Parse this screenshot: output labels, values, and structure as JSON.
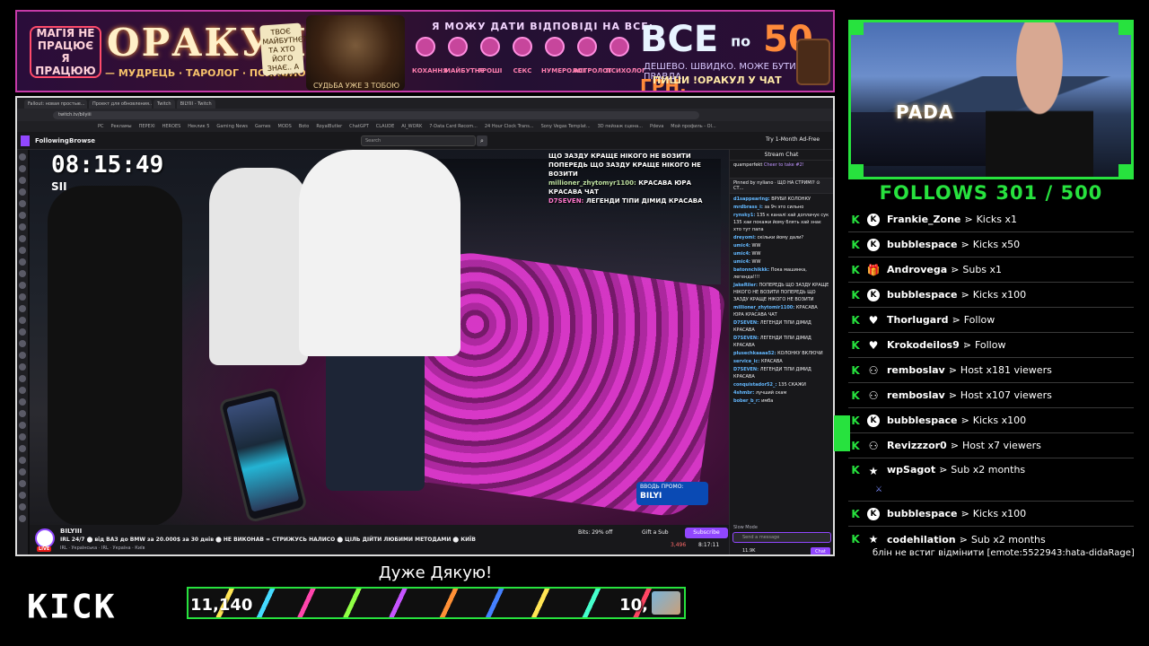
{
  "banner": {
    "left_pill": "МАГІЯ НЕ ПРАЦЮЄ Я ПРАЦЮЮ",
    "title": "ОРАКУЛ",
    "subtitle": "— МУДРЕЦЬ · ТАРОЛОГ · ПСИХОЛОГ —",
    "future_card": "ТВОЄ МАЙБУТНЄ? ТА ХТО ЙОГО ЗНАЄ.. А Я ЗНАЮ",
    "wizard_label": "СУДЬБА УЖЕ З ТОБОЮ",
    "can_answer": "Я МОЖУ ДАТИ ВІДПОВІДІ НА ВСЕ:",
    "categories": [
      "КОХАННЯ",
      "МАЙБУТНЄ",
      "ГРОШІ",
      "СЕКС",
      "НУМЕРОЛОГ",
      "АСТРОЛОГ",
      "ПСИХОЛОГ"
    ],
    "price_all": "ВСЕ",
    "price_po": "по",
    "price_num": "50",
    "price_cur": "ГРН.",
    "price_sub": "ДЕШЕВО. ШВИДКО. МОЖЕ БУТИ ПРАВДА.",
    "price_cta": "ПИШИ !ОРАКУЛ У ЧАТ"
  },
  "browser": {
    "tabs": [
      "Fallout: новая простые...",
      "Проект для обновления...",
      "Twitch",
      "BILYIII - Twitch"
    ],
    "url": "twitch.tv/bilyiii",
    "bookmarks": [
      "PC",
      "Рекламы",
      "ПЕРЕХІ",
      "HEROES",
      "Неклик 5",
      "Gaming News",
      "Games",
      "MODS",
      "Boto",
      "RoyalButler",
      "ChatGPT",
      "CLAUDE",
      "AI_WORK",
      "7-Data Card Recom...",
      "24 Hour Clock Trans...",
      "Sony Vegas Templat...",
      "3D пейзаж сцена...",
      "Pdeva",
      "Мой профиль - Ol..."
    ]
  },
  "twitch_nav": {
    "following": "Following",
    "browse": "Browse",
    "search_placeholder": "Search",
    "adfree": "Try 1-Month Ad-Free"
  },
  "video": {
    "clock": "08:15:49",
    "clock_sub": "SII",
    "overlay_chat": [
      {
        "text": "ЩО ЗАЗДУ КРАЩЕ НІКОГО НЕ ВОЗИТИ ПОПЕРЕДЬ ЩО ЗАЗДУ КРАЩЕ НІКОГО НЕ ВОЗИТИ"
      },
      {
        "name": "millioner_zhytomyr1100:",
        "text": "КРАСАВА ЮРА КРАСАВА ЧАТ"
      },
      {
        "name": "D7SEVEN:",
        "text": "ЛЕГЕНДИ ТІПИ ДІМИД КРАСАВА"
      }
    ],
    "promo_line1": "ВВОДЬ ПРОМО:",
    "promo_code": "BILYI"
  },
  "info": {
    "channel": "BILYIII",
    "live_badge": "LIVE",
    "title": "IRL 24/7 ⬤ від ВАЗ до BMW за 20.000$ за 30 днів ⬤ НЕ ВИКОНАВ = СТРИЖУСЬ НАЛИСО ⬤ ЦІЛЬ ДІЙТИ ЛЮБИМИ МЕТОДАМИ ⬤ КИЇВ",
    "tags": "IRL · Українська · IRL · Україна · Київ",
    "bits": "Bits: 29% off",
    "gift": "Gift a Sub",
    "subscribe": "Subscribe",
    "viewers": "3,496",
    "uptime": "8:17:11"
  },
  "chat": {
    "header": "Stream Chat",
    "hype_user": "quamperfekt",
    "hype_text": "Cheer to take #2!",
    "pinned": "Pinned by nyliano · ЩО НА СТРИМІ? ⊙ СТ...",
    "messages": [
      {
        "u": "d1sappearing:",
        "t": "ВРУБИ КОЛОНКУ"
      },
      {
        "u": "mrdbrass_i:",
        "t": "за 9ч это сильно"
      },
      {
        "u": "rynsky1:",
        "t": "135 к каналі хай доплачує сук 135 хаи покажи йому блять хай знає хто тут папа"
      },
      {
        "u": "dreyomi:",
        "t": "скільки йому дали?"
      },
      {
        "u": "umic4:",
        "t": "WW"
      },
      {
        "u": "umic4:",
        "t": "WW"
      },
      {
        "u": "umic4:",
        "t": "WW"
      },
      {
        "u": "batonnchikkk:",
        "t": "Пока машинка, легенда!!!!"
      },
      {
        "u": "JakeRiler:",
        "t": "ПОПЕРЕДЬ ЩО ЗАЗДУ КРАЩЕ НІКОГО НЕ ВОЗИТИ ПОПЕРЕДЬ ЩО ЗАЗДУ КРАЩЕ НІКОГО НЕ ВОЗИТИ"
      },
      {
        "u": "millioner_zhytomir1100:",
        "t": "КРАСАВА ЮРА КРАСАВА ЧАТ"
      },
      {
        "u": "D7SEVEN:",
        "t": "ЛЕГЕНДИ ТІПИ ДІМИД КРАСАВА"
      },
      {
        "u": "D7SEVEN:",
        "t": "ЛЕГЕНДИ ТІПИ ДІМИД КРАСАВА"
      },
      {
        "u": "plusechkaaaa52:",
        "t": "КОЛОНКУ ВКЛЮЧИ"
      },
      {
        "u": "service_ic:",
        "t": "КРАСАВА"
      },
      {
        "u": "D7SEVEN:",
        "t": "ЛЕГЕНДИ ТІПИ ДІМИД КРАСАВА"
      },
      {
        "u": "conquistador52_:",
        "t": "135 СКАЖИ"
      },
      {
        "u": "4shmbr:",
        "t": "лучший скам"
      },
      {
        "u": "bober_b_r:",
        "t": "имба"
      }
    ],
    "slow_mode": "Slow Mode",
    "input_placeholder": "Send a message",
    "points": "11.9K",
    "chat_btn": "Chat"
  },
  "cam": {
    "sign": "PADA"
  },
  "follows": "FOLLOWS 301 / 500",
  "events": [
    {
      "user": "Frankie_Zone",
      "action": "Kicks x1",
      "icon": "kick-circle-icon",
      "glyph": "K"
    },
    {
      "user": "bubblespace",
      "action": "Kicks x50",
      "icon": "kick-circle-icon",
      "glyph": "K"
    },
    {
      "user": "Androvega",
      "action": "Subs x1",
      "icon": "gift-icon",
      "glyph": "🎁"
    },
    {
      "user": "bubblespace",
      "action": "Kicks x100",
      "icon": "kick-circle-icon",
      "glyph": "K"
    },
    {
      "user": "Thorlugard",
      "action": "Follow",
      "icon": "heart-icon",
      "glyph": "♥"
    },
    {
      "user": "Krokodeilos9",
      "action": "Follow",
      "icon": "heart-icon",
      "glyph": "♥"
    },
    {
      "user": "remboslav",
      "action": "Host x181 viewers",
      "icon": "host-users-icon",
      "glyph": "⚇"
    },
    {
      "user": "remboslav",
      "action": "Host x107 viewers",
      "icon": "host-users-icon",
      "glyph": "⚇"
    },
    {
      "user": "bubblespace",
      "action": "Kicks x100",
      "icon": "kick-circle-icon",
      "glyph": "K"
    },
    {
      "user": "Revizzzor0",
      "action": "Host x7 viewers",
      "icon": "host-users-icon",
      "glyph": "⚇"
    },
    {
      "user": "wpSagot",
      "action": "Sub x2 months",
      "icon": "star-icon",
      "glyph": "★"
    },
    {
      "user": "bubblespace",
      "action": "Kicks x100",
      "icon": "kick-circle-icon",
      "glyph": "K"
    },
    {
      "user": "codehilation",
      "action": "Sub x2 months",
      "icon": "star-icon",
      "glyph": "★"
    }
  ],
  "events_k": "K",
  "events_arrow": "⋗",
  "sub_message": "блін не встиг відмінити [emote:5522943:hata-didaRage]",
  "kick_logo": "KICK",
  "goal": {
    "title": "Дуже Дякую!",
    "current": "11,140",
    "target": "10,",
    "progress": 1.0
  },
  "colors": {
    "accent_green": "#27e23e",
    "twitch_purple": "#9147ff",
    "banner_border": "#c63aa8"
  }
}
